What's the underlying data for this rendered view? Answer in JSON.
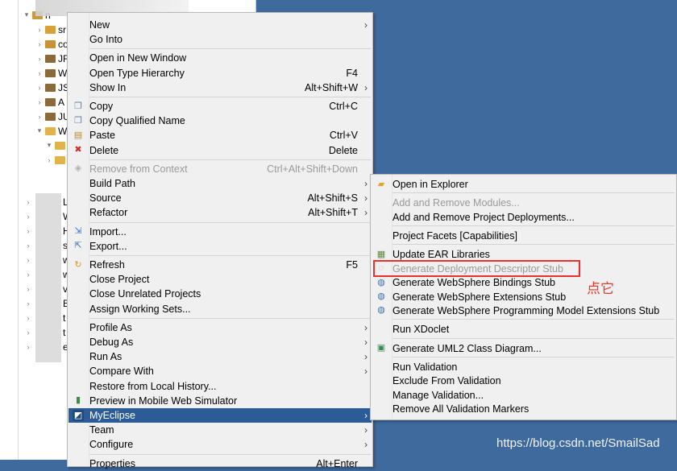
{
  "colors": {
    "accent": "#2b5c98",
    "desktop": "#3f6a9e",
    "annotation": "#e8302c"
  },
  "tree": {
    "rows": [
      {
        "label": "n",
        "icon": "project-folder-icon"
      },
      {
        "label": "sr",
        "icon": "source-folder-icon"
      },
      {
        "label": "co",
        "icon": "package-icon"
      },
      {
        "label": "JR",
        "icon": "library-icon"
      },
      {
        "label": "W",
        "icon": "library-icon"
      },
      {
        "label": "JS",
        "icon": "library-icon"
      },
      {
        "label": "A",
        "icon": "library-icon"
      },
      {
        "label": "JU",
        "icon": "library-icon"
      },
      {
        "label": "W",
        "icon": "folder-icon"
      },
      {
        "label": "",
        "icon": "folder-icon"
      },
      {
        "label": "",
        "icon": "folder-icon"
      }
    ],
    "blurred_rows": [
      "L",
      "W",
      "H",
      "s",
      "w",
      "w",
      "v",
      "B",
      "t",
      "t",
      "ef"
    ]
  },
  "main_menu": {
    "items": [
      {
        "type": "item",
        "label": "New",
        "submenu": true
      },
      {
        "type": "item",
        "label": "Go Into"
      },
      {
        "type": "sep"
      },
      {
        "type": "item",
        "label": "Open in New Window"
      },
      {
        "type": "item",
        "label": "Open Type Hierarchy",
        "shortcut": "F4"
      },
      {
        "type": "item",
        "label": "Show In",
        "shortcut": "Alt+Shift+W",
        "submenu": true
      },
      {
        "type": "sep"
      },
      {
        "type": "item",
        "label": "Copy",
        "shortcut": "Ctrl+C",
        "icon": "copy-icon"
      },
      {
        "type": "item",
        "label": "Copy Qualified Name",
        "icon": "copy-icon"
      },
      {
        "type": "item",
        "label": "Paste",
        "shortcut": "Ctrl+V",
        "icon": "paste-icon"
      },
      {
        "type": "item",
        "label": "Delete",
        "shortcut": "Delete",
        "icon": "delete-icon"
      },
      {
        "type": "sep"
      },
      {
        "type": "item",
        "label": "Remove from Context",
        "shortcut": "Ctrl+Alt+Shift+Down",
        "icon": "remove-context-icon",
        "disabled": true
      },
      {
        "type": "item",
        "label": "Build Path",
        "submenu": true
      },
      {
        "type": "item",
        "label": "Source",
        "shortcut": "Alt+Shift+S",
        "submenu": true
      },
      {
        "type": "item",
        "label": "Refactor",
        "shortcut": "Alt+Shift+T",
        "submenu": true
      },
      {
        "type": "sep"
      },
      {
        "type": "item",
        "label": "Import...",
        "icon": "import-icon"
      },
      {
        "type": "item",
        "label": "Export...",
        "icon": "export-icon"
      },
      {
        "type": "sep"
      },
      {
        "type": "item",
        "label": "Refresh",
        "shortcut": "F5",
        "icon": "refresh-icon"
      },
      {
        "type": "item",
        "label": "Close Project"
      },
      {
        "type": "item",
        "label": "Close Unrelated Projects"
      },
      {
        "type": "item",
        "label": "Assign Working Sets..."
      },
      {
        "type": "sep"
      },
      {
        "type": "item",
        "label": "Profile As",
        "submenu": true
      },
      {
        "type": "item",
        "label": "Debug As",
        "submenu": true
      },
      {
        "type": "item",
        "label": "Run As",
        "submenu": true
      },
      {
        "type": "item",
        "label": "Compare With",
        "submenu": true
      },
      {
        "type": "item",
        "label": "Restore from Local History..."
      },
      {
        "type": "item",
        "label": "Preview in Mobile Web Simulator",
        "icon": "mobile-preview-icon"
      },
      {
        "type": "item",
        "label": "MyEclipse",
        "submenu": true,
        "icon": "myeclipse-icon",
        "highlighted": true
      },
      {
        "type": "item",
        "label": "Team",
        "submenu": true
      },
      {
        "type": "item",
        "label": "Configure",
        "submenu": true
      },
      {
        "type": "sep"
      },
      {
        "type": "item",
        "label": "Properties",
        "shortcut": "Alt+Enter"
      }
    ]
  },
  "sub_menu": {
    "items": [
      {
        "type": "item",
        "label": "Open in Explorer",
        "icon": "explorer-icon"
      },
      {
        "type": "sep"
      },
      {
        "type": "item",
        "label": "Add and Remove Modules...",
        "disabled": true
      },
      {
        "type": "item",
        "label": "Add and Remove Project Deployments..."
      },
      {
        "type": "sep"
      },
      {
        "type": "item",
        "label": "Project Facets [Capabilities]"
      },
      {
        "type": "sep"
      },
      {
        "type": "item",
        "label": "Update EAR Libraries",
        "icon": "ear-libraries-icon"
      },
      {
        "type": "item",
        "label": "Generate Deployment Descriptor Stub",
        "icon": "descriptor-stub-icon",
        "disabled": true
      },
      {
        "type": "item",
        "label": "Generate WebSphere Bindings Stub",
        "icon": "websphere-icon"
      },
      {
        "type": "item",
        "label": "Generate WebSphere Extensions Stub",
        "icon": "websphere-icon"
      },
      {
        "type": "item",
        "label": "Generate WebSphere Programming Model Extensions Stub",
        "icon": "websphere-icon"
      },
      {
        "type": "sep"
      },
      {
        "type": "item",
        "label": "Run XDoclet"
      },
      {
        "type": "sep"
      },
      {
        "type": "item",
        "label": "Generate UML2 Class Diagram...",
        "icon": "uml-diagram-icon"
      },
      {
        "type": "sep"
      },
      {
        "type": "item",
        "label": "Run Validation"
      },
      {
        "type": "item",
        "label": "Exclude From Validation"
      },
      {
        "type": "item",
        "label": "Manage Validation..."
      },
      {
        "type": "item",
        "label": "Remove All Validation Markers"
      }
    ]
  },
  "annotation": {
    "text": "点它"
  },
  "watermark": {
    "text": "https://blog.csdn.net/SmailSad"
  }
}
